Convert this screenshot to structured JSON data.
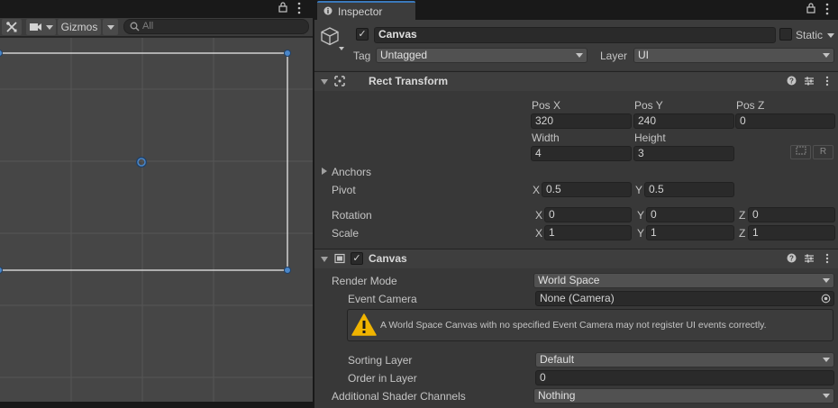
{
  "scene": {
    "toolbar": {
      "gizmos_label": "Gizmos",
      "search_placeholder": "All"
    }
  },
  "inspector": {
    "tab_label": "Inspector",
    "object": {
      "name": "Canvas",
      "active_checked": true,
      "static_label": "Static",
      "static_checked": false,
      "tag_label": "Tag",
      "tag_value": "Untagged",
      "layer_label": "Layer",
      "layer_value": "UI"
    },
    "rect_transform": {
      "title": "Rect Transform",
      "pos_x_label": "Pos X",
      "pos_y_label": "Pos Y",
      "pos_z_label": "Pos Z",
      "pos_x": "320",
      "pos_y": "240",
      "pos_z": "0",
      "width_label": "Width",
      "height_label": "Height",
      "width": "4",
      "height": "3",
      "r_button": "R",
      "anchors_label": "Anchors",
      "pivot_label": "Pivot",
      "pivot_x": "0.5",
      "pivot_y": "0.5",
      "rotation_label": "Rotation",
      "rotation_x": "0",
      "rotation_y": "0",
      "rotation_z": "0",
      "scale_label": "Scale",
      "scale_x": "1",
      "scale_y": "1",
      "scale_z": "1",
      "axis_x": "X",
      "axis_y": "Y",
      "axis_z": "Z"
    },
    "canvas": {
      "title": "Canvas",
      "enabled": true,
      "render_mode_label": "Render Mode",
      "render_mode_value": "World Space",
      "event_camera_label": "Event Camera",
      "event_camera_value": "None (Camera)",
      "warning_text": "A World Space Canvas with no specified Event Camera may not register UI events correctly.",
      "sorting_layer_label": "Sorting Layer",
      "sorting_layer_value": "Default",
      "order_in_layer_label": "Order in Layer",
      "order_in_layer_value": "0",
      "shader_channels_label": "Additional Shader Channels",
      "shader_channels_value": "Nothing"
    }
  },
  "colors": {
    "accent_blue": "#3a79bb",
    "warning_yellow": "#f0b400",
    "handle_blue": "#4a86c8"
  }
}
